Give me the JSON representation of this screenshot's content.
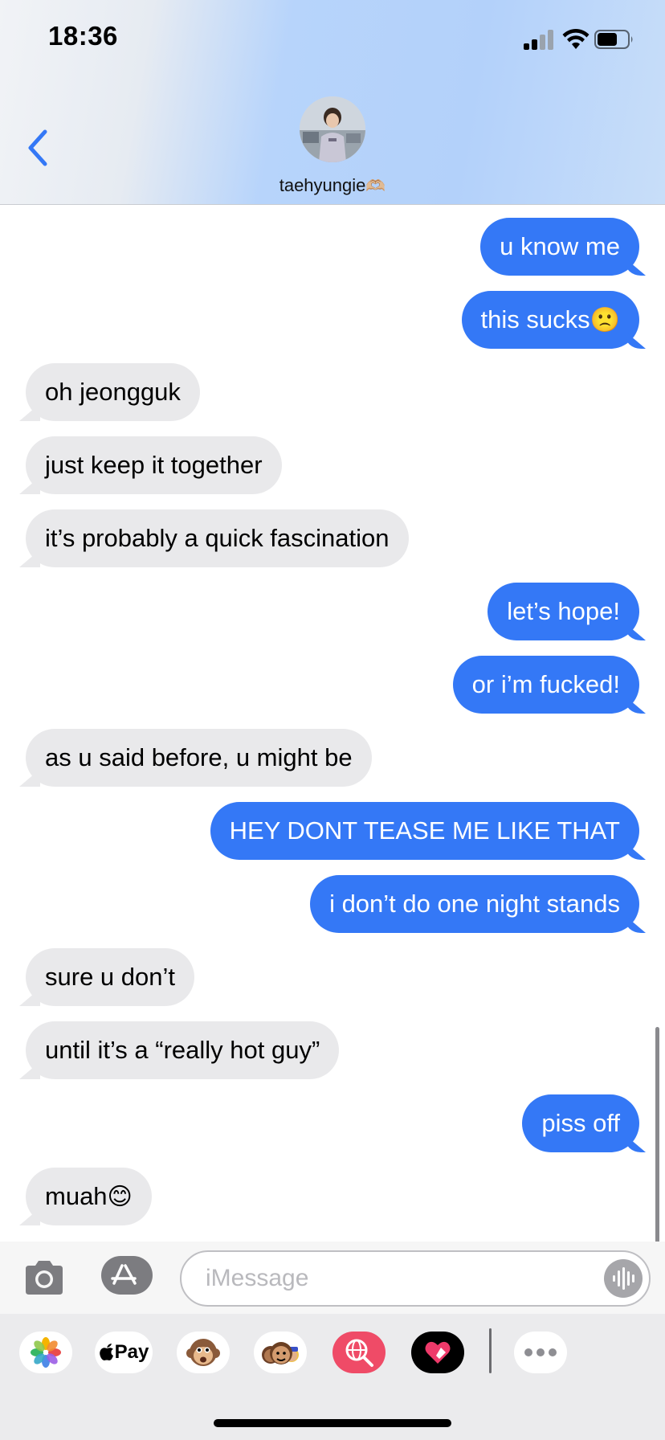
{
  "status_bar": {
    "time": "18:36"
  },
  "header": {
    "contact_name": "taehyungie",
    "contact_emoji": "🫶🏼"
  },
  "messages": [
    {
      "sender": "me",
      "text": "u know me",
      "emoji": ""
    },
    {
      "sender": "me",
      "text": "this sucks",
      "emoji": "🙁"
    },
    {
      "sender": "them",
      "text": "oh jeongguk",
      "emoji": ""
    },
    {
      "sender": "them",
      "text": "just keep it together",
      "emoji": ""
    },
    {
      "sender": "them",
      "text": "it’s probably a quick fascination",
      "emoji": ""
    },
    {
      "sender": "me",
      "text": "let’s hope!",
      "emoji": ""
    },
    {
      "sender": "me",
      "text": "or i’m fucked!",
      "emoji": ""
    },
    {
      "sender": "them",
      "text": "as u said before, u might be",
      "emoji": ""
    },
    {
      "sender": "me",
      "text": "HEY DONT TEASE ME LIKE THAT",
      "emoji": ""
    },
    {
      "sender": "me",
      "text": "i don’t do one night stands",
      "emoji": ""
    },
    {
      "sender": "them",
      "text": "sure u don’t",
      "emoji": ""
    },
    {
      "sender": "them",
      "text": "until it’s a “really hot guy”",
      "emoji": ""
    },
    {
      "sender": "me",
      "text": "piss off",
      "emoji": ""
    },
    {
      "sender": "them",
      "text": "muah",
      "emoji": "😊"
    }
  ],
  "compose": {
    "placeholder": "iMessage"
  },
  "drawer": {
    "apps": [
      {
        "name": "photos-icon"
      },
      {
        "name": "apple-pay-icon",
        "label": "Pay"
      },
      {
        "name": "animoji-icon"
      },
      {
        "name": "memoji-icon"
      },
      {
        "name": "web-search-icon"
      },
      {
        "name": "digital-touch-icon"
      },
      {
        "name": "more-icon"
      }
    ]
  },
  "colors": {
    "sent_bubble": "#3478f6",
    "received_bubble": "#e9e9eb",
    "accent": "#3478f6"
  }
}
